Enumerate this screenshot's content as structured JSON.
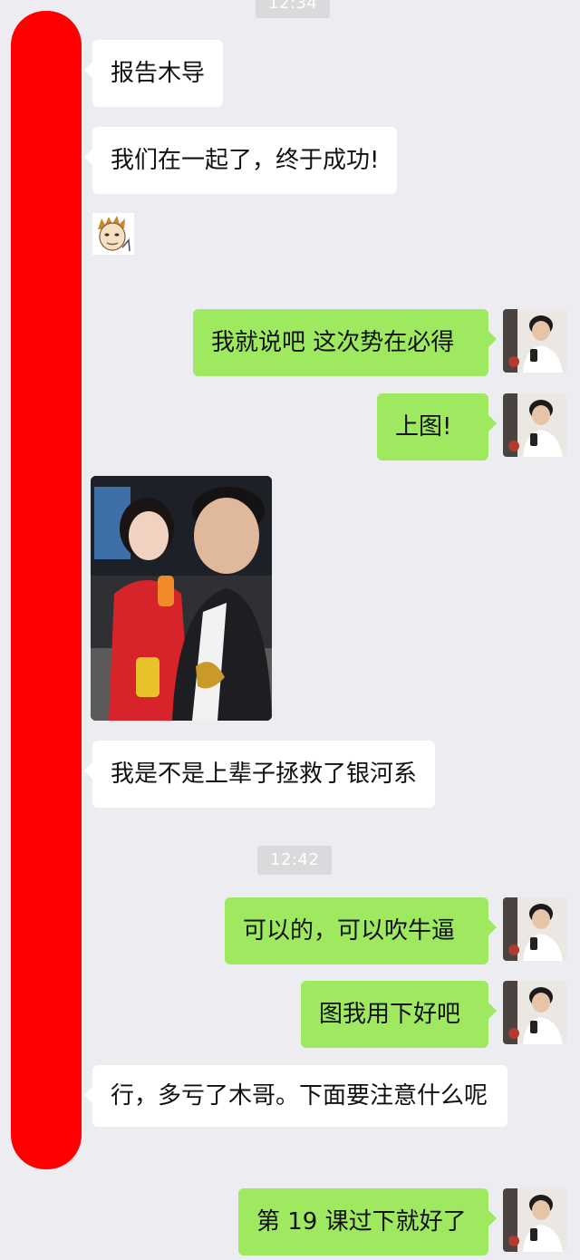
{
  "timestamps": [
    "12:34",
    "12:42"
  ],
  "messages": {
    "m1": "报告木导",
    "m2": "我们在一起了，终于成功!",
    "m3": "我就说吧 这次势在必得",
    "m4": "上图!",
    "m5": "我是不是上辈子拯救了银河系",
    "m6": "可以的，可以吹牛逼",
    "m7": "图我用下好吧",
    "m8": "行，多亏了木哥。下面要注意什么呢",
    "m9": "第 19 课过下就好了"
  },
  "colors": {
    "background": "#ececf1",
    "incoming_bubble": "#ffffff",
    "outgoing_bubble": "#9ee960",
    "redaction_bar": "#ff0000",
    "timestamp_bg": "#dadadc"
  },
  "icons": {
    "sticker": "cartoon-face-sticker",
    "avatar": "user-avatar"
  }
}
